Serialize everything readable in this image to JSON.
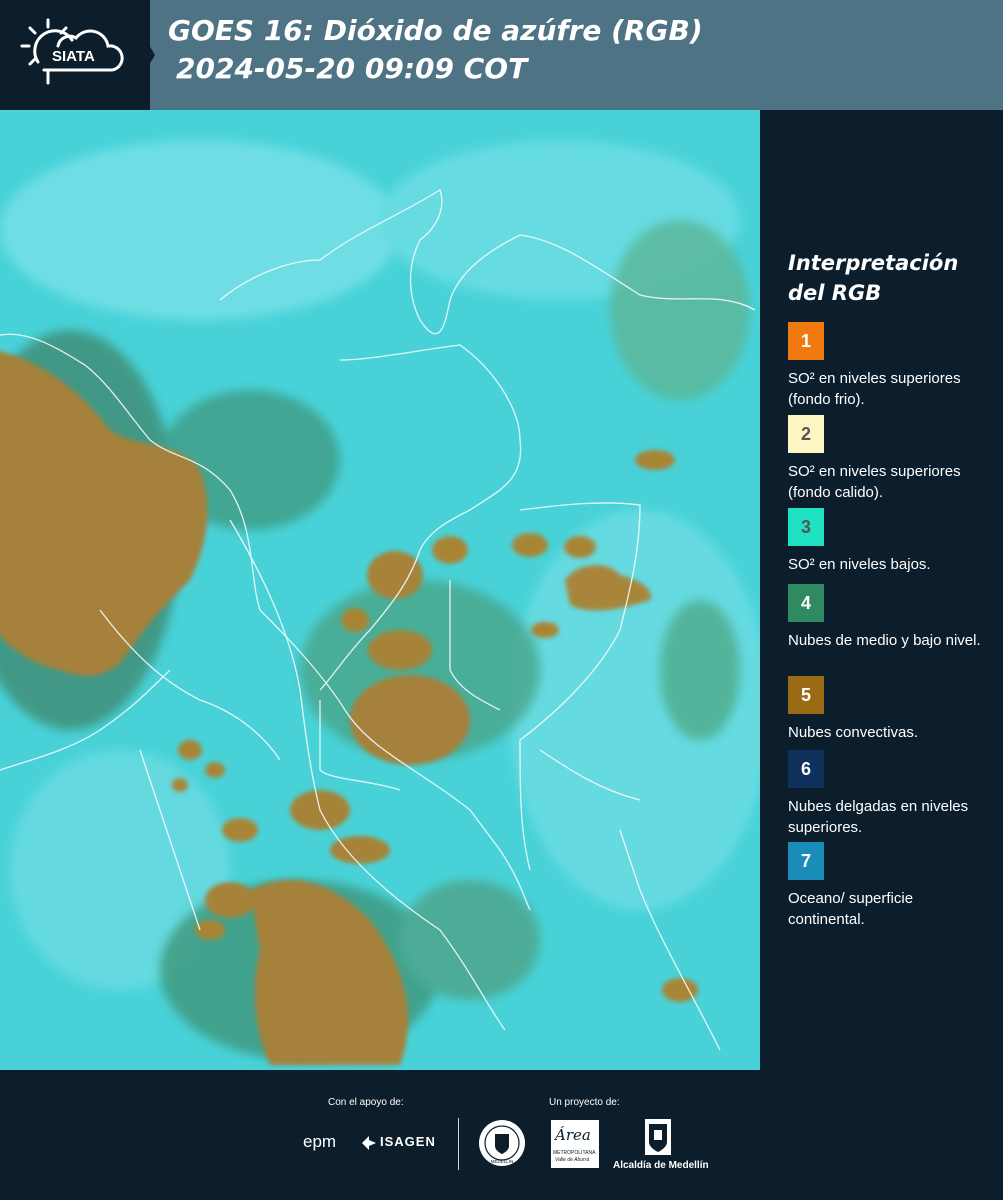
{
  "header": {
    "logo_text": "SIATA",
    "title_line1": "GOES 16: Dióxido de azúfre (RGB)",
    "title_line2": "2024-05-20 09:09 COT"
  },
  "map": {
    "colors": {
      "background": "#48d2d8",
      "convective": "#a5813a",
      "mid_low": "#3f8f78"
    }
  },
  "legend": {
    "title_line1": "Interpretación",
    "title_line2": "del RGB",
    "items": [
      {
        "number": "1",
        "text": "SO² en niveles superiores (fondo frio).",
        "color": "#f07a10"
      },
      {
        "number": "2",
        "text": "SO² en niveles superiores (fondo calido).",
        "color": "#fdf6c4"
      },
      {
        "number": "3",
        "text": "SO² en niveles bajos.",
        "color": "#1ee2c1"
      },
      {
        "number": "4",
        "text": "Nubes de medio y bajo nivel.",
        "color": "#2f8a62"
      },
      {
        "number": "5",
        "text": "Nubes convectivas.",
        "color": "#9a6b12"
      },
      {
        "number": "6",
        "text": "Nubes delgadas en niveles superiores.",
        "color": "#10315e"
      },
      {
        "number": "7",
        "text": "Oceano/ superficie continental.",
        "color": "#1a8cb8"
      }
    ]
  },
  "footer": {
    "support_label": "Con el apoyo de:",
    "project_label": "Un proyecto de:",
    "epm": "epm",
    "isagen": "ISAGEN",
    "metro_word": "Área",
    "metro_sub": "METROPOLITANA",
    "metro_sub2": "Valle de Aburrá",
    "alcaldia": "Alcaldía de Medellín",
    "seal_text": "MEDELLÍN"
  }
}
